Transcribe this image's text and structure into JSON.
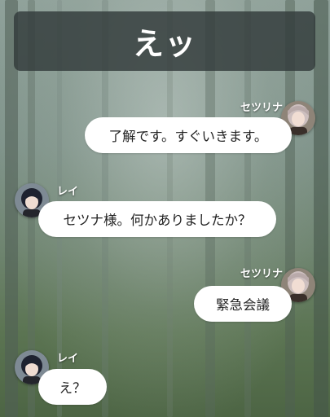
{
  "header": {
    "title": "えッ"
  },
  "messages": [
    {
      "sender": "セツリナ",
      "text": "了解です。すぐいきます。"
    },
    {
      "sender": "レイ",
      "text": "セツナ様。何かありましたか？"
    },
    {
      "sender": "セツリナ",
      "text": "緊急会議"
    },
    {
      "sender": "レイ",
      "text": "え？"
    }
  ],
  "avatars": {
    "setsurina": {
      "hair_color": "#cdbfbf",
      "bg_color": "#8e8478"
    },
    "rei": {
      "hair_color": "#1e2230",
      "bg_color": "#7e8a94"
    }
  },
  "colors": {
    "header_bg": "#323a3a",
    "bubble_bg": "#ffffff",
    "name_text": "#ffffff",
    "forest_light": "#8fa19a",
    "forest_dark": "#4d6544"
  }
}
